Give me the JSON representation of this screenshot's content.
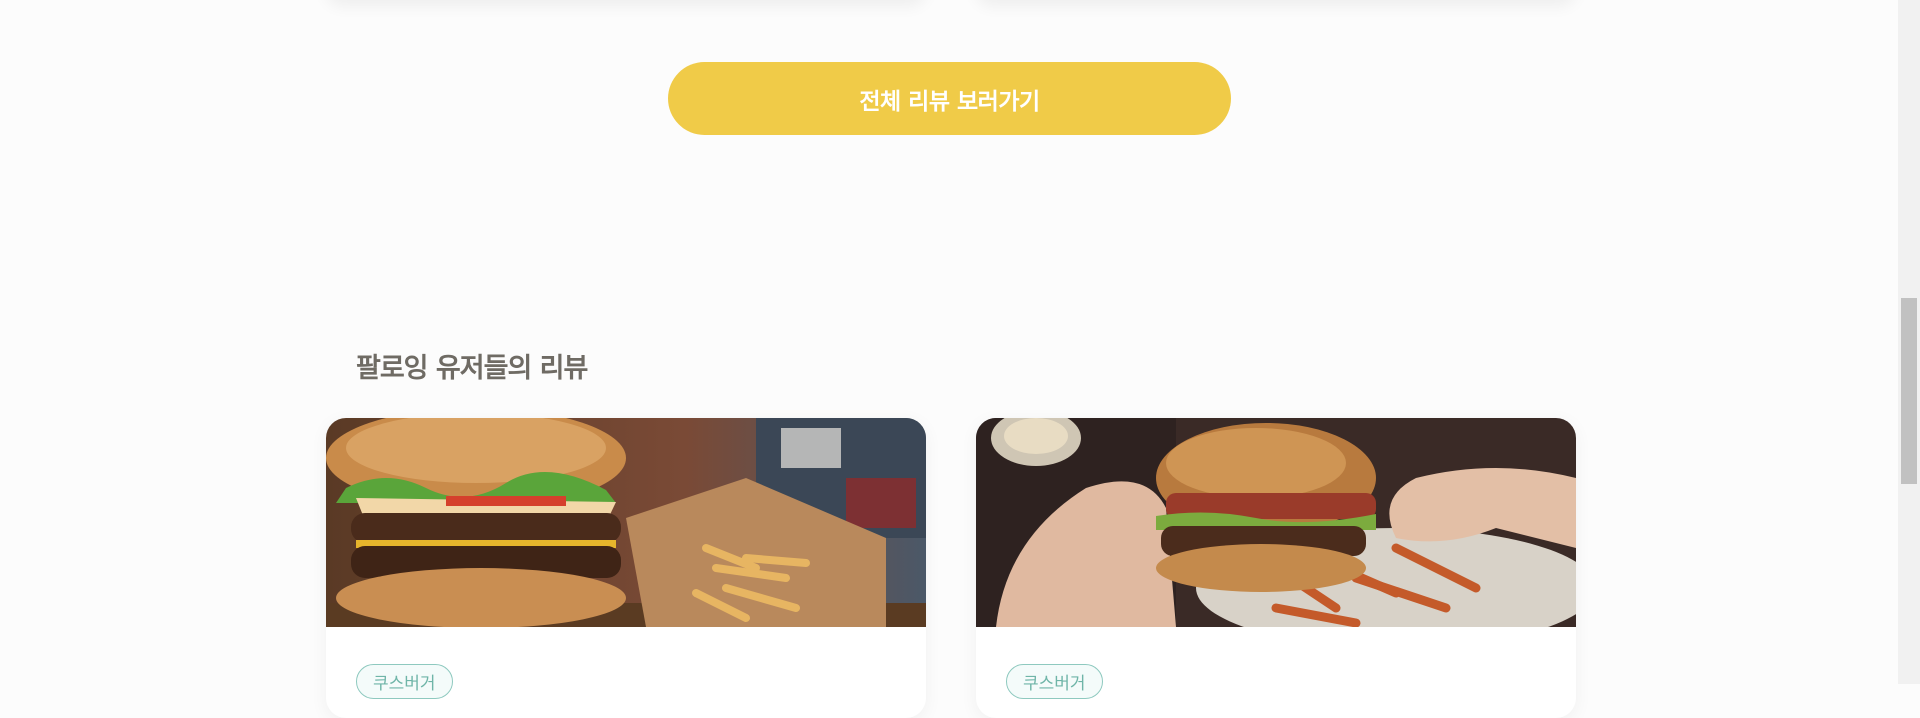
{
  "view_all_button": {
    "label": "전체 리뷰 보러가기"
  },
  "section": {
    "title": "팔로잉 유저들의 리뷰"
  },
  "reviews": [
    {
      "tag": "쿠스버거",
      "image_icon": "burger-and-fries-photo"
    },
    {
      "tag": "쿠스버거",
      "image_icon": "hands-holding-burger-photo"
    }
  ],
  "colors": {
    "accent": "#f0cb48",
    "title": "#6f6b64",
    "tag": "#6fb5a8",
    "background": "#fcfcfc"
  }
}
